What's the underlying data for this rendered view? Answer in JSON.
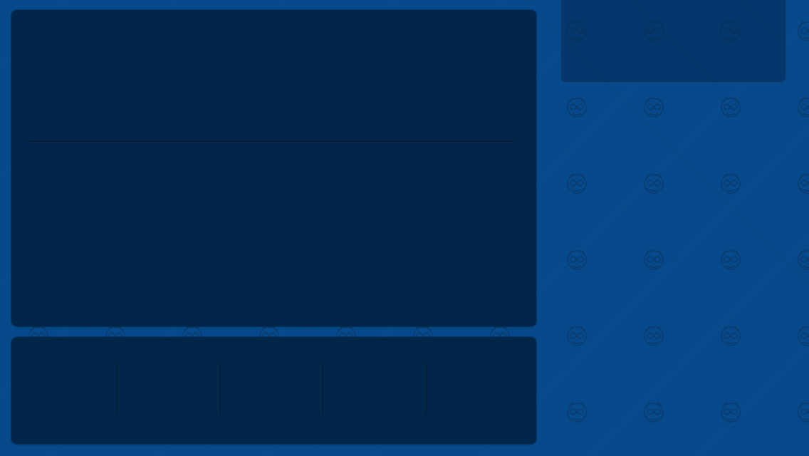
{
  "app": {
    "background_color": "#064a8c",
    "panel_color": "#02264a",
    "pattern_icon": "mascot-face-icon"
  },
  "main_panel": {
    "title": "",
    "content": ""
  },
  "bottom_bar": {
    "items": [
      "",
      "",
      "",
      "",
      ""
    ]
  },
  "side_panel": {
    "content": ""
  }
}
